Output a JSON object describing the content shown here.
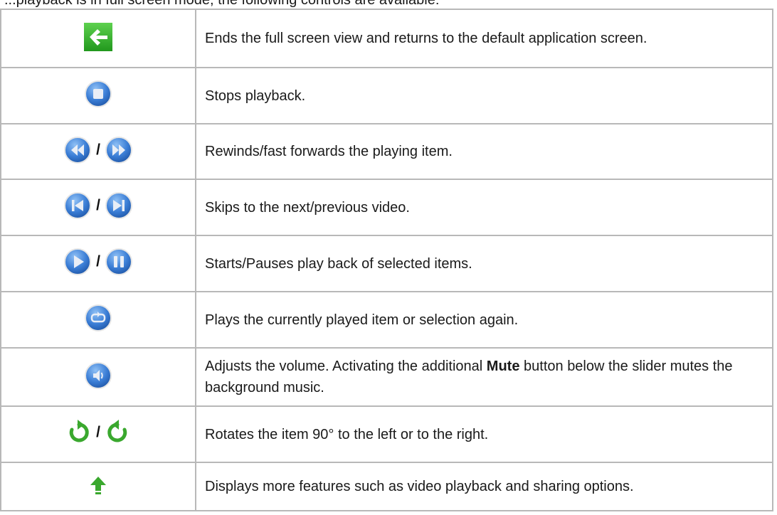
{
  "intro_text": "...playback is in full screen mode, the following controls are available:",
  "rows": [
    {
      "icons": [
        "back-arrow-icon"
      ],
      "desc": "Ends the full screen view and returns to the default application screen."
    },
    {
      "icons": [
        "stop-icon"
      ],
      "desc": "Stops playback."
    },
    {
      "icons": [
        "rewind-icon",
        "fast-forward-icon"
      ],
      "separator": "/",
      "desc": "Rewinds/fast forwards the playing item."
    },
    {
      "icons": [
        "skip-previous-icon",
        "skip-next-icon"
      ],
      "separator": "/",
      "desc": "Skips to the next/previous video."
    },
    {
      "icons": [
        "play-icon",
        "pause-icon"
      ],
      "separator": "/",
      "desc": "Starts/Pauses play back of selected items."
    },
    {
      "icons": [
        "repeat-icon"
      ],
      "desc": "Plays the currently played item or selection again."
    },
    {
      "icons": [
        "volume-icon"
      ],
      "desc_before": "Adjusts the volume. Activating the additional ",
      "desc_bold": "Mute",
      "desc_after": " button below the slider mutes the background music."
    },
    {
      "icons": [
        "rotate-left-icon",
        "rotate-right-icon"
      ],
      "separator": "/",
      "desc": "Rotates the item 90° to the left or to the right."
    },
    {
      "icons": [
        "more-features-arrow-icon"
      ],
      "desc": "Displays more features such as video playback and sharing options."
    }
  ],
  "colors": {
    "border": "#b8b8b8",
    "blue_button": "#2f6fc4",
    "green": "#3aa82e"
  }
}
